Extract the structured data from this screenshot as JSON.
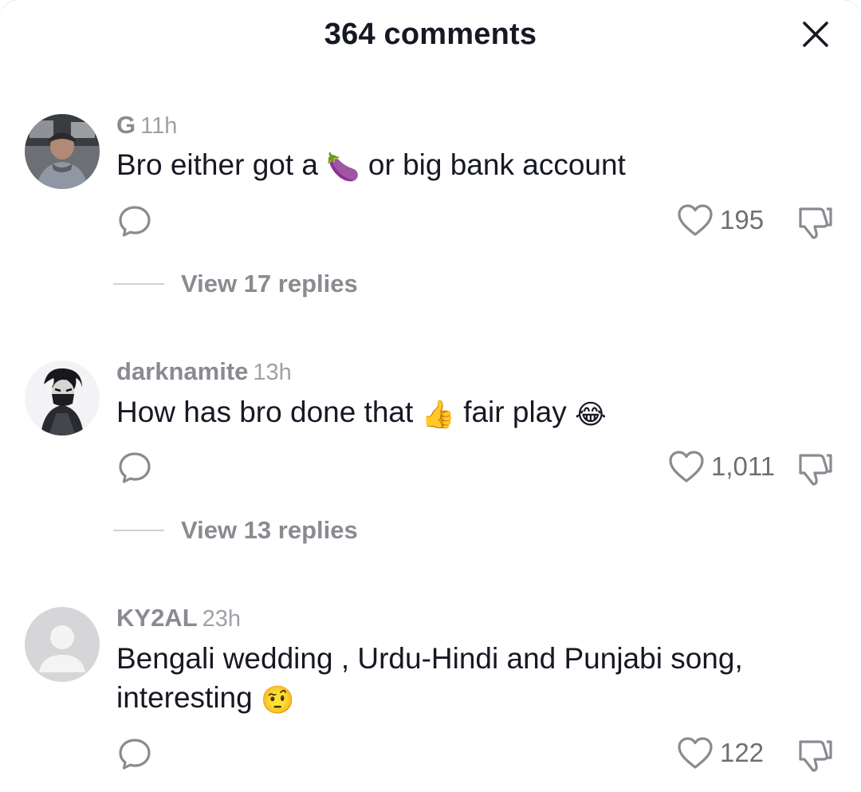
{
  "header": {
    "title": "364 comments"
  },
  "comments": [
    {
      "username": "G",
      "time": "11h",
      "text_before": "Bro either got a ",
      "emoji1": "🍆",
      "text_after": " or big bank account",
      "likes": "195",
      "view_replies": "View 17 replies"
    },
    {
      "username": "darknamite",
      "time": "13h",
      "text_before": "How has bro done that ",
      "emoji1": "👍",
      "text_middle": " fair play ",
      "emoji2": "😂",
      "likes": "1,011",
      "view_replies": "View 13 replies"
    },
    {
      "username": "KY2AL",
      "time": "23h",
      "text_line1": "Bengali wedding , Urdu-Hindi and Punjabi song,",
      "text_line2": "interesting ",
      "emoji1": "🤨",
      "likes": "122"
    }
  ],
  "icons": {
    "close": "close-icon",
    "reply": "reply-bubble-icon",
    "like": "heart-outline-icon",
    "dislike": "thumbs-down-icon"
  },
  "colors": {
    "text_primary": "#161823",
    "text_secondary": "#8a8b91",
    "divider": "#d0d1d4"
  }
}
